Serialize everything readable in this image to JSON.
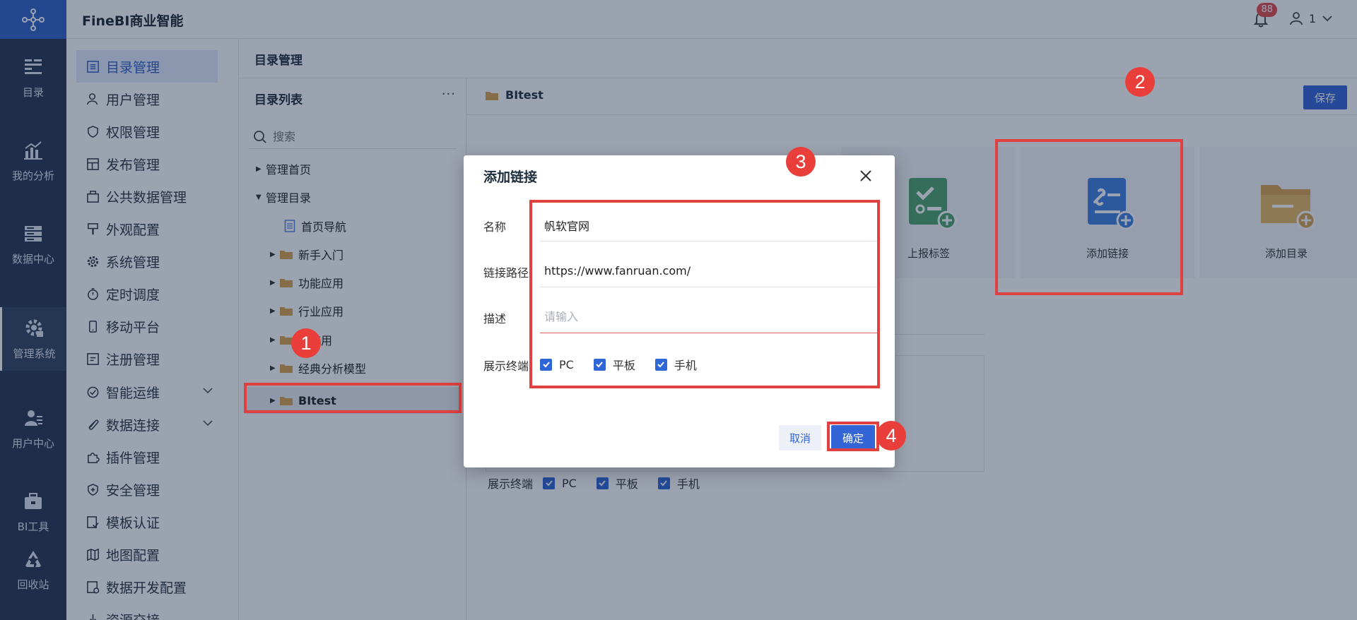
{
  "app": {
    "brand": "FineBI商业智能"
  },
  "header": {
    "notification_count": "88",
    "user_name": "1"
  },
  "rail": {
    "items": [
      {
        "label": "目录",
        "icon": "catalog-icon"
      },
      {
        "label": "我的分析",
        "icon": "analysis-icon"
      },
      {
        "label": "数据中心",
        "icon": "data-center-icon"
      },
      {
        "label": "管理系统",
        "icon": "gear-icon"
      },
      {
        "label": "用户中心",
        "icon": "user-center-icon"
      },
      {
        "label": "BI工具",
        "icon": "toolbox-icon"
      },
      {
        "label": "回收站",
        "icon": "recycle-icon"
      }
    ],
    "active": "管理系统"
  },
  "menu": {
    "items": [
      {
        "label": "目录管理",
        "icon": "list-icon"
      },
      {
        "label": "用户管理",
        "icon": "user-icon"
      },
      {
        "label": "权限管理",
        "icon": "shield-icon"
      },
      {
        "label": "发布管理",
        "icon": "publish-icon"
      },
      {
        "label": "公共数据管理",
        "icon": "database-icon"
      },
      {
        "label": "外观配置",
        "icon": "brush-icon"
      },
      {
        "label": "系统管理",
        "icon": "gear-icon"
      },
      {
        "label": "定时调度",
        "icon": "timer-icon"
      },
      {
        "label": "移动平台",
        "icon": "mobile-icon"
      },
      {
        "label": "注册管理",
        "icon": "register-icon"
      },
      {
        "label": "智能运维",
        "icon": "ops-icon"
      },
      {
        "label": "数据连接",
        "icon": "link-icon"
      },
      {
        "label": "插件管理",
        "icon": "plugin-icon"
      },
      {
        "label": "安全管理",
        "icon": "security-icon"
      },
      {
        "label": "模板认证",
        "icon": "template-icon"
      },
      {
        "label": "地图配置",
        "icon": "map-icon"
      },
      {
        "label": "数据开发配置",
        "icon": "dev-config-icon"
      },
      {
        "label": "资源交接",
        "icon": "handover-icon"
      }
    ]
  },
  "content": {
    "title": "目录管理"
  },
  "tree": {
    "title": "目录列表",
    "more": "···",
    "search_placeholder": "搜索",
    "nodes": {
      "home": "管理首页",
      "catalog": "管理目录",
      "nav": "首页导航",
      "newbie": "新手入门",
      "feature": "功能应用",
      "industry": "行业应用",
      "hidden": "应用",
      "classic": "经典分析模型",
      "bitest": "BItest"
    }
  },
  "main": {
    "folder_name": "BItest",
    "save_label": "保存",
    "cards": {
      "report_tag": "上报标签",
      "add_link": "添加链接",
      "add_folder": "添加目录"
    },
    "terminals_label": "展示终端",
    "terminals": [
      "PC",
      "平板",
      "手机"
    ]
  },
  "dialog": {
    "title": "添加链接",
    "name_label": "名称",
    "name_value": "帆软官网",
    "path_label": "链接路径",
    "path_value": "https://www.fanruan.com/",
    "desc_label": "描述",
    "desc_placeholder": "请输入",
    "terminals_label": "展示终端",
    "terminals": [
      "PC",
      "平板",
      "手机"
    ],
    "cancel_label": "取消",
    "ok_label": "确定"
  },
  "steps": [
    "1",
    "2",
    "3",
    "4"
  ],
  "colors": {
    "primary": "#3365d6",
    "rail": "#26354f",
    "highlight": "#e0403f"
  }
}
